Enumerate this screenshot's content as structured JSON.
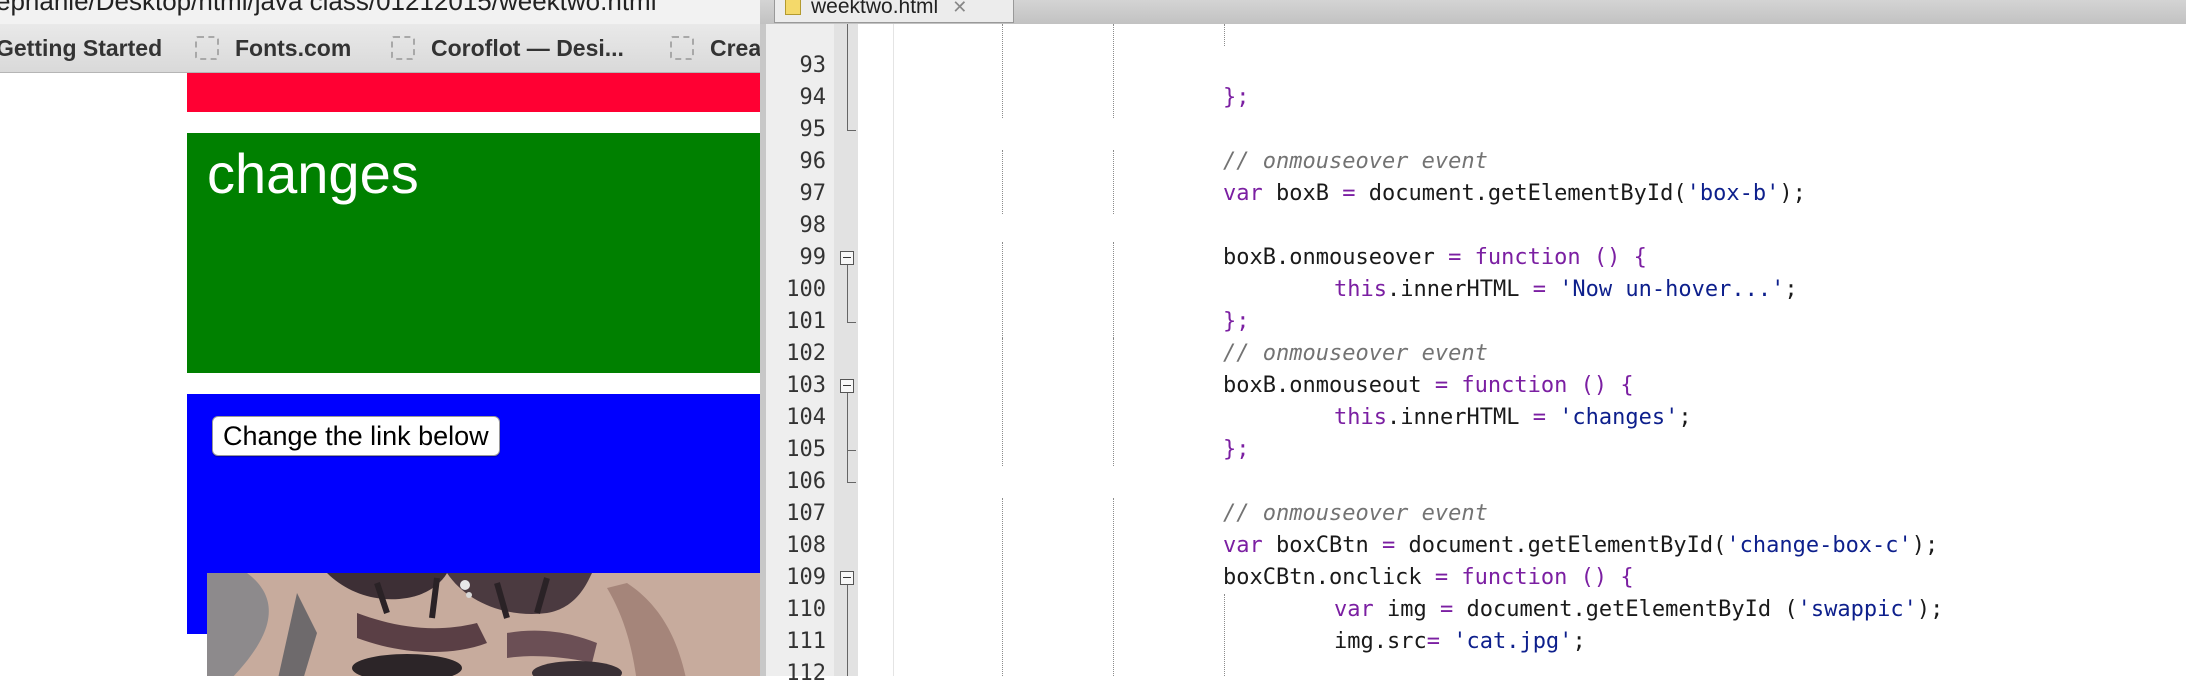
{
  "browser": {
    "address_url": "ephanie/Desktop/html/java class/01212015/weektwo.html",
    "bookmarks": [
      {
        "label": "Getting Started",
        "icon": "bookmark-page-icon"
      },
      {
        "label": "Fonts.com",
        "icon": "bookmark-page-icon"
      },
      {
        "label": "Coroflot — Desi...",
        "icon": "bookmark-page-icon"
      },
      {
        "label": "Crea",
        "icon": "bookmark-page-icon"
      }
    ],
    "page": {
      "box_a_color": "#ff0033",
      "box_b_color": "#008000",
      "box_b_text": "changes",
      "box_c_color": "#0000ff",
      "change_button_label": "Change the link below"
    }
  },
  "editor": {
    "tab_label": "weektwo.html",
    "colors": {
      "keyword": "#7b1fa2",
      "default": "#1a1a1a",
      "string": "#0d1f8c",
      "comment": "#737373",
      "gutter_bg": "#eeeeee"
    },
    "lines": [
      {
        "number": "93",
        "tokens": []
      },
      {
        "number": "94",
        "tokens": [
          {
            "text": "};",
            "style": "keyword"
          }
        ]
      },
      {
        "number": "95",
        "tokens": []
      },
      {
        "number": "96",
        "tokens": [
          {
            "text": "// onmouseover event",
            "style": "comment"
          }
        ]
      },
      {
        "number": "97",
        "tokens": [
          {
            "text": "var",
            "style": "keyword"
          },
          {
            "text": " boxB ",
            "style": "default"
          },
          {
            "text": "=",
            "style": "keyword"
          },
          {
            "text": " document.getElementById(",
            "style": "default"
          },
          {
            "text": "'box-b'",
            "style": "string"
          },
          {
            "text": ");",
            "style": "default"
          }
        ]
      },
      {
        "number": "98",
        "tokens": []
      },
      {
        "number": "99",
        "tokens": [
          {
            "text": "boxB.onmouseover ",
            "style": "default"
          },
          {
            "text": "=",
            "style": "keyword"
          },
          {
            "text": " function () {",
            "style": "keyword"
          }
        ]
      },
      {
        "number": "100",
        "tokens": [
          {
            "text": "this",
            "style": "keyword"
          },
          {
            "text": ".innerHTML ",
            "style": "default"
          },
          {
            "text": "=",
            "style": "keyword"
          },
          {
            "text": " ",
            "style": "default"
          },
          {
            "text": "'Now un-hover...'",
            "style": "string"
          },
          {
            "text": ";",
            "style": "default"
          }
        ]
      },
      {
        "number": "101",
        "tokens": [
          {
            "text": "};",
            "style": "keyword"
          }
        ]
      },
      {
        "number": "102",
        "tokens": [
          {
            "text": "// onmouseover event",
            "style": "comment"
          }
        ]
      },
      {
        "number": "103",
        "tokens": [
          {
            "text": "boxB.onmouseout ",
            "style": "default"
          },
          {
            "text": "=",
            "style": "keyword"
          },
          {
            "text": " function () {",
            "style": "keyword"
          }
        ]
      },
      {
        "number": "104",
        "tokens": [
          {
            "text": "this",
            "style": "keyword"
          },
          {
            "text": ".innerHTML ",
            "style": "default"
          },
          {
            "text": "=",
            "style": "keyword"
          },
          {
            "text": " ",
            "style": "default"
          },
          {
            "text": "'changes'",
            "style": "string"
          },
          {
            "text": ";",
            "style": "default"
          }
        ]
      },
      {
        "number": "105",
        "tokens": [
          {
            "text": "};",
            "style": "keyword"
          }
        ]
      },
      {
        "number": "106",
        "tokens": []
      },
      {
        "number": "107",
        "tokens": [
          {
            "text": "// onmouseover event",
            "style": "comment"
          }
        ]
      },
      {
        "number": "108",
        "tokens": [
          {
            "text": "var",
            "style": "keyword"
          },
          {
            "text": " boxCBtn ",
            "style": "default"
          },
          {
            "text": "=",
            "style": "keyword"
          },
          {
            "text": " document.getElementById(",
            "style": "default"
          },
          {
            "text": "'change-box-c'",
            "style": "string"
          },
          {
            "text": ");",
            "style": "default"
          }
        ]
      },
      {
        "number": "109",
        "tokens": [
          {
            "text": "boxCBtn.onclick ",
            "style": "default"
          },
          {
            "text": "=",
            "style": "keyword"
          },
          {
            "text": " function () {",
            "style": "keyword"
          }
        ]
      },
      {
        "number": "110",
        "tokens": [
          {
            "text": "var",
            "style": "keyword"
          },
          {
            "text": " img ",
            "style": "default"
          },
          {
            "text": "=",
            "style": "keyword"
          },
          {
            "text": " document.getElementById (",
            "style": "default"
          },
          {
            "text": "'swappic'",
            "style": "string"
          },
          {
            "text": ");",
            "style": "default"
          }
        ]
      },
      {
        "number": "111",
        "tokens": [
          {
            "text": "img.src",
            "style": "default"
          },
          {
            "text": "=",
            "style": "keyword"
          },
          {
            "text": " ",
            "style": "default"
          },
          {
            "text": "'cat.jpg'",
            "style": "string"
          },
          {
            "text": ";",
            "style": "default"
          }
        ]
      },
      {
        "number": "112",
        "tokens": []
      }
    ]
  }
}
